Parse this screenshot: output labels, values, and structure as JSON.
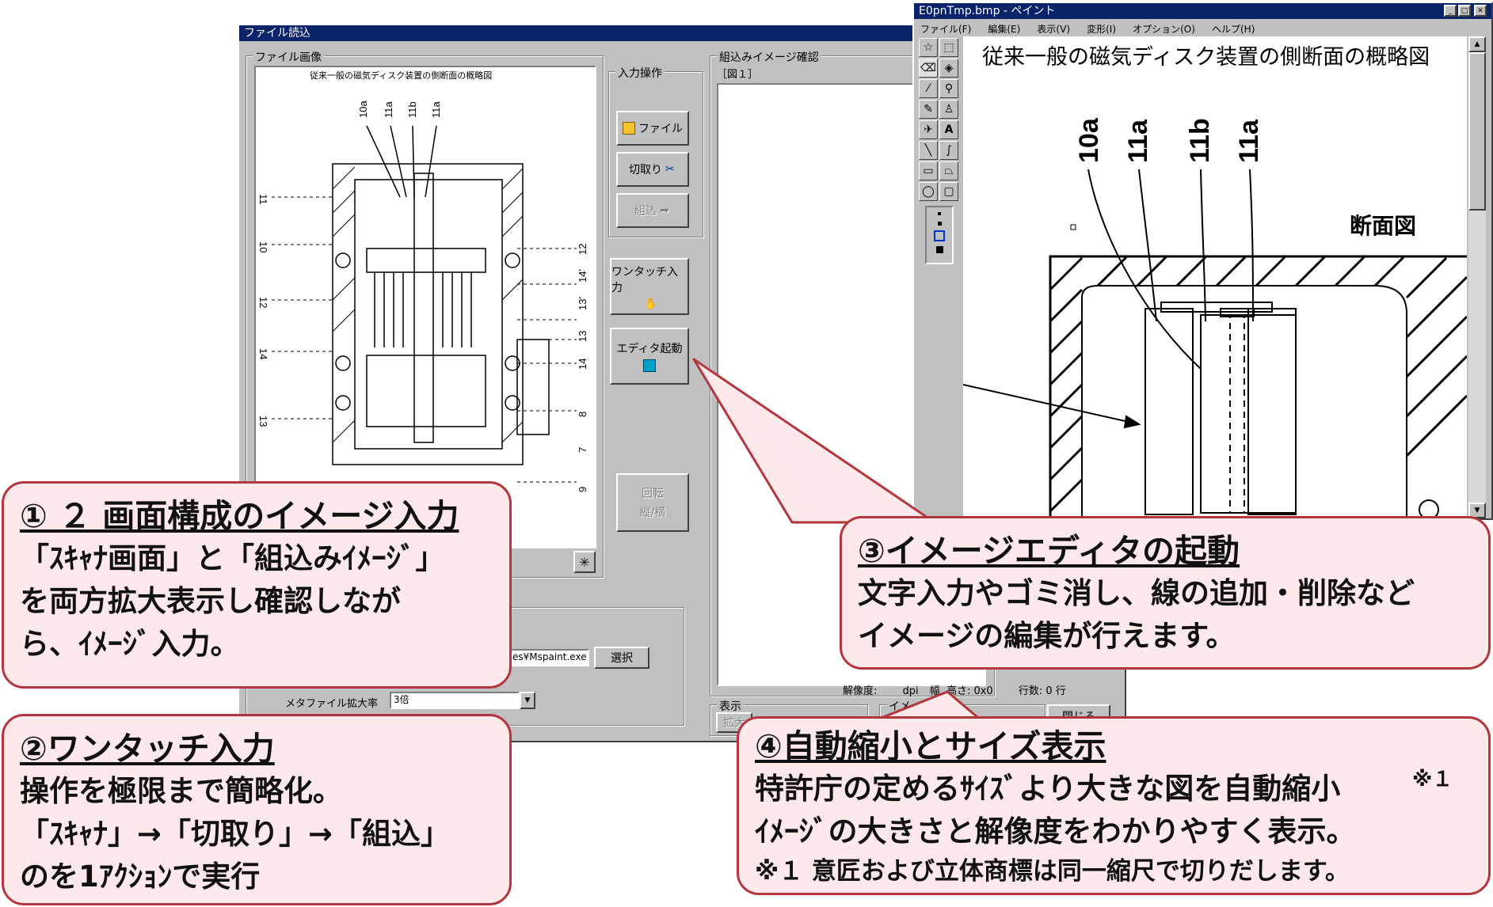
{
  "main_window": {
    "title": "ファイル読込",
    "group_file_image": "ファイル画像",
    "group_input_ops": "入力操作",
    "group_assembly": "組込みイメージ確認",
    "figure_label": "［図１］",
    "btn_file": "ファイル",
    "btn_cut": "切取り",
    "btn_assemble": "組込",
    "btn_onetouch": "ワンタッチ入力",
    "btn_editor": "エディタ起動",
    "btn_rotate_1": "回転",
    "btn_rotate_2": "縦/横",
    "editor_path": "es¥Mspaint.exe",
    "btn_select": "選択",
    "metafile_label": "メタファイル拡大率",
    "metafile_value": "3倍",
    "status_resolution": "解像度:",
    "status_dpi": "dpi",
    "status_width": "幅",
    "status_height": "高さ: 0x0",
    "status_rows": "行数: 0 行",
    "group_display": "表示",
    "btn_zoom": "拡大",
    "group_image": "イメージ",
    "btn_close": "閉じる"
  },
  "scan": {
    "caption": "従来一般の磁気ディスク装置の側断面の概略図",
    "top_labels": [
      "10a",
      "11a",
      "11b",
      "11a"
    ],
    "left_labels": [
      "11",
      "10",
      "12",
      "14",
      "13"
    ],
    "right_labels": [
      "12",
      "14'",
      "13'",
      "13",
      "14",
      "8",
      "7",
      "9"
    ]
  },
  "paint_window": {
    "title": "E0pnTmp.bmp - ペイント",
    "menus": [
      "ファイル(F)",
      "編集(E)",
      "表示(V)",
      "変形(I)",
      "オプション(O)",
      "ヘルプ(H)"
    ],
    "caption": "従来一般の磁気ディスク装置の側断面の概略図",
    "labels": [
      "10a",
      "11a",
      "11b",
      "11a"
    ],
    "section_label": "断面図"
  },
  "callouts": {
    "c1": {
      "title": "① ２ 画面構成のイメージ入力",
      "lines": [
        "「ｽｷｬﾅ画面」と「組込みｲﾒｰｼﾞ」",
        "を両方拡大表示し確認しなが",
        "ら、ｲﾒｰｼﾞ入力。"
      ]
    },
    "c2": {
      "title": "②ワンタッチ入力",
      "lines": [
        "操作を極限まで簡略化。",
        "「ｽｷｬﾅ」→「切取り」→「組込」",
        "のを1ｱｸｼｮﾝで実行"
      ]
    },
    "c3": {
      "title": "③イメージエディタの起動",
      "lines": [
        "文字入力やゴミ消し、線の追加・削除など",
        "イメージの編集が行えます。"
      ]
    },
    "c4": {
      "title": "④自動縮小とサイズ表示",
      "lines": [
        "特許庁の定めるｻｲｽﾞより大きな図を自動縮小",
        "ｲﾒｰｼﾞの大きさと解像度をわかりやすく表示。"
      ],
      "mark": "※１",
      "note": "※１ 意匠および立体商標は同一縮尺で切りだします。"
    }
  },
  "colors": {
    "callout_fill": "#fde8ea",
    "callout_border": "#b3363f",
    "titlebar": "#0a246a"
  }
}
